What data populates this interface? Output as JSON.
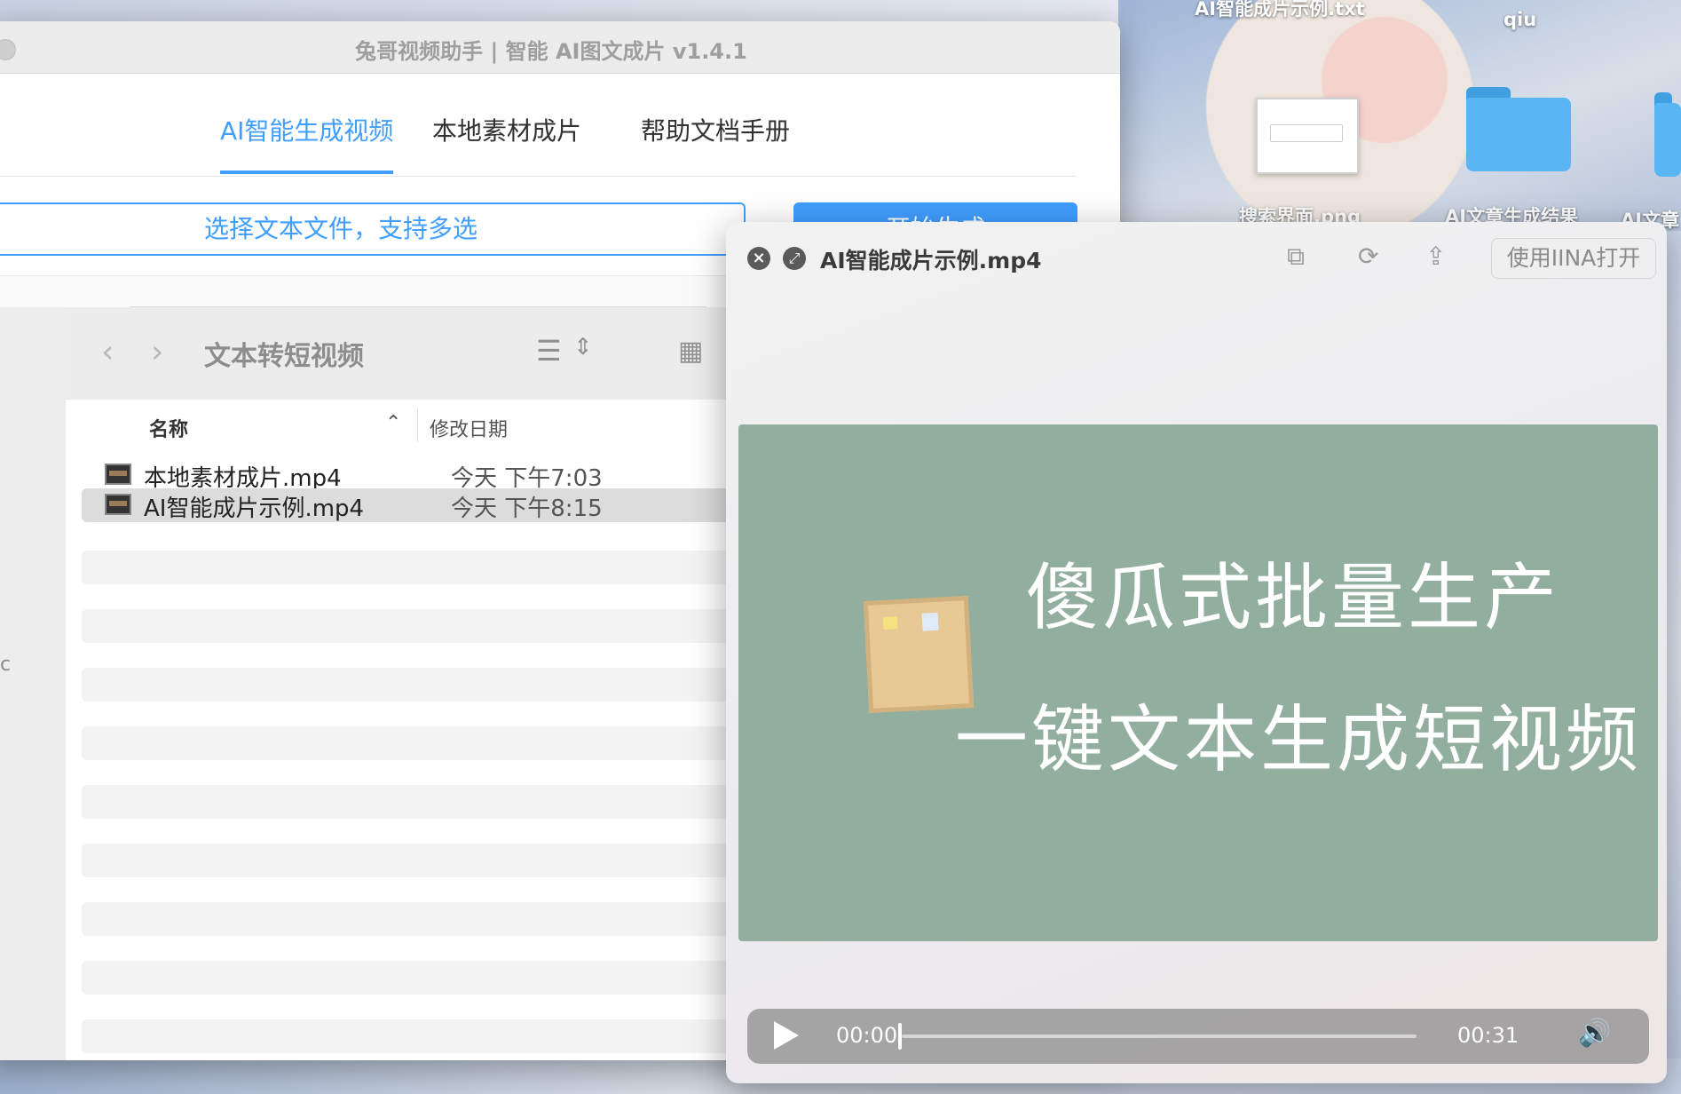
{
  "desktop": {
    "labels": [
      "AI智能成片示例.txt",
      "qiu",
      "搜索界面.png",
      "AI文章生成结果",
      "AI文章"
    ]
  },
  "app": {
    "title": "兔哥视频助手 | 智能 AI图文成片 v1.4.1",
    "tabs": [
      {
        "label": "AI智能生成视频",
        "active": true
      },
      {
        "label": "本地素材成片",
        "active": false
      },
      {
        "label": "帮助文档手册",
        "active": false
      }
    ],
    "file_select_placeholder": "选择文本文件，支持多选",
    "start_button": "开始生成",
    "accent_color": "#409eff"
  },
  "finder": {
    "folder_title": "文本转短视频",
    "sidebar_fragment": "c",
    "columns": {
      "name": "名称",
      "date": "修改日期"
    },
    "files": [
      {
        "name": "本地素材成片.mp4",
        "date": "今天 下午7:03",
        "selected": false
      },
      {
        "name": "AI智能成片示例.mp4",
        "date": "今天 下午8:15",
        "selected": true
      }
    ],
    "icons": {
      "back": "chevron-left-icon",
      "forward": "chevron-right-icon",
      "list": "list-view-icon",
      "sort": "sort-icon",
      "grid": "grid-view-icon"
    }
  },
  "quicklook": {
    "title": "AI智能成片示例.mp4",
    "open_button": "使用IINA打开",
    "video_text": {
      "line1": "傻瓜式批量生产",
      "line2": "一键文本生成短视频"
    },
    "video_bg": "#92ae9f",
    "player": {
      "current_time": "00:00",
      "total_time": "00:31",
      "progress": 0.0
    }
  }
}
